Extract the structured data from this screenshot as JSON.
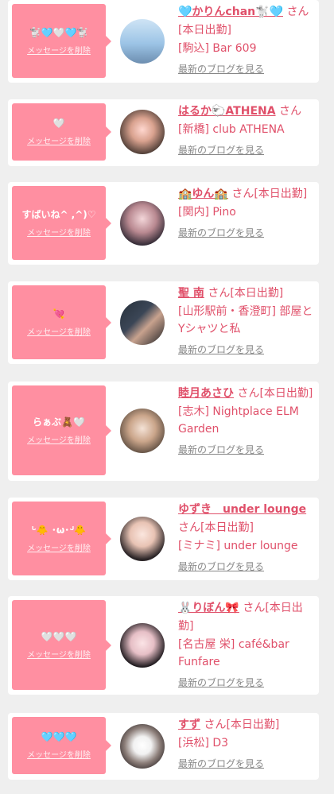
{
  "delete_label": "メッセージを削除",
  "blog_label": "最新のブログを見る",
  "cards": [
    {
      "message": "🐩🩵🤍🩵🐩",
      "name": "🩵かりんchan🐩🩵",
      "suffix": "さん[本日出勤]",
      "shop": "[駒込] Bar 609"
    },
    {
      "message": "🤍",
      "name": "はるか🐑ATHENA",
      "suffix": "さん",
      "shop": "[新橋] club ATHENA"
    },
    {
      "message": "すばいね^ ,^)♡",
      "name": "🏫ゆん🏫",
      "suffix": "さん[本日出勤]",
      "shop": "[関内] Pino"
    },
    {
      "message": "💘",
      "name": "聖 南",
      "suffix": "さん[本日出勤]",
      "shop": "[山形駅前・香澄町] 部屋とYシャツと私"
    },
    {
      "message": "らぁぶ🧸🤍",
      "name": "睦月あさひ",
      "suffix": "さん[本日出勤]",
      "shop": "[志木] Nightplace ELM Garden"
    },
    {
      "message": "ᒡ🐥 ･ω･ᒢ🐥",
      "name": "ゆずき　under lounge",
      "suffix": "さん[本日出勤]",
      "shop": "[ミナミ] under lounge"
    },
    {
      "message": "🤍🤍🤍",
      "name": "🐰りぼん🎀",
      "suffix": "さん[本日出勤]",
      "shop": "[名古屋 栄] café&bar Funfare"
    },
    {
      "message": "🩵🩵🩵",
      "name": "すず",
      "suffix": "さん[本日出勤]",
      "shop": "[浜松] D3"
    }
  ]
}
